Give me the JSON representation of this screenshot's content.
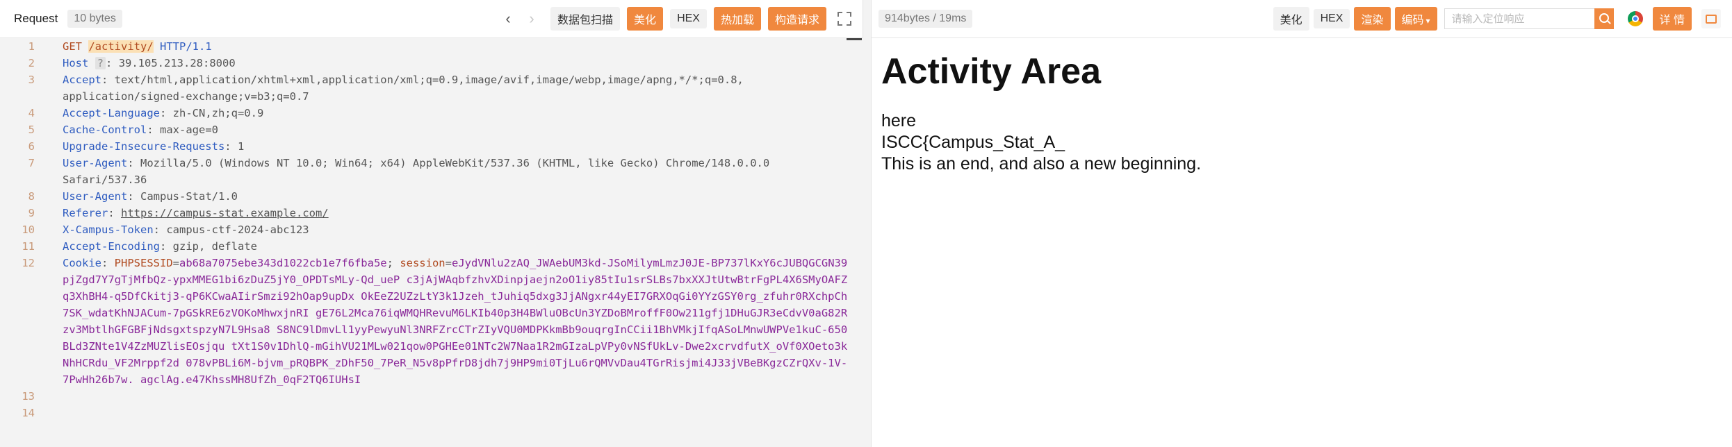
{
  "request": {
    "title": "Request",
    "size": "10 bytes",
    "nav_prev": "‹",
    "nav_next": "›",
    "scan_label": "数据包扫描",
    "beautify_label": "美化",
    "hex_label": "HEX",
    "hotload_label": "热加载",
    "construct_label": "构造请求",
    "hint": "?",
    "lines": {
      "l1": {
        "n": "1",
        "method": "GET",
        "path": "/activity/",
        "proto": "HTTP/1.1"
      },
      "l2": {
        "n": "2",
        "k": "Host",
        "v": "39.105.213.28:8000"
      },
      "l3": {
        "n": "3",
        "k": "Accept",
        "v": "text/html,application/xhtml+xml,application/xml;q=0.9,image/avif,image/webp,image/apng,*/*;q=0.8,",
        "v2": "application/signed-exchange;v=b3;q=0.7"
      },
      "l4": {
        "n": "4",
        "k": "Accept-Language",
        "v": "zh-CN,zh;q=0.9"
      },
      "l5": {
        "n": "5",
        "k": "Cache-Control",
        "v": "max-age=0"
      },
      "l6": {
        "n": "6",
        "k": "Upgrade-Insecure-Requests",
        "v": "1"
      },
      "l7": {
        "n": "7",
        "k": "User-Agent",
        "v": "Mozilla/5.0 (Windows NT 10.0; Win64; x64) AppleWebKit/537.36 (KHTML, like Gecko) Chrome/148.0.0.0",
        "v2": "Safari/537.36"
      },
      "l8": {
        "n": "8",
        "k": "User-Agent",
        "v": "Campus-Stat/1.0"
      },
      "l9": {
        "n": "9",
        "k": "Referer",
        "v": "https://campus-stat.example.com/"
      },
      "l10": {
        "n": "10",
        "k": "X-Campus-Token",
        "v": "campus-ctf-2024-abc123"
      },
      "l11": {
        "n": "11",
        "k": "Accept-Encoding",
        "v": "gzip, deflate"
      },
      "l12": {
        "n": "12",
        "k": "Cookie",
        "c1k": "PHPSESSID",
        "c1v": "ab68a7075ebe343d1022cb1e7f6fba5e",
        "c2k": "session",
        "c2v": "eJydVNlu2zAQ_JWAebUM3kd-JSoMilymLmzJ0JE-BP737lKxY6cJUBQGCGN39pjZgd7Y7gTjMfbQz-ypxMMEG1bi6zDuZ5jY0_OPDTsMLy-Qd_ueP c3jAjWAqbfzhvXDinpjaejn2oO1iy85tIu1srSLBs7bxXXJtUtwBtrFgPL4X6SMyOAFZq3XhBH4-q5DfCkitj3-qP6KCwaAIirSmzi92hOap9upDx OkEeZ2UZzLtY3k1Jzeh_tJuhiq5dxg3JjANgxr44yEI7GRXOqGi0YYzGSY0rg_zfuhr0RXchpCh7SK_wdatKhNJACum-7pGSkRE6zVOKoMhwxjnRI gE76L2Mca76iqWMQHRevuM6LKIb40p3H4BWluOBcUn3YZDoBMroffF0Ow211gfj1DHuGJR3eCdvV0aG82Rzv3MbtlhGFGBFjNdsgxtspzyN7L9Hsa8 S8NC9lDmvLl1yyPewyuNl3NRFZrcCTrZIyVQU0MDPKkmBb9ouqrgInCCii1BhVMkjIfqASoLMnwUWPVe1kuC-650BLd3ZNte1V4ZzMUZlisEOsjqu tXt1S0v1DhlQ-mGihVU21MLw021qow0PGHEe01NTc2W7Naa1R2mGIzaLpVPy0vNSfUkLv-Dwe2xcrvdfutX_oVf0XOeto3kNhHCRdu_VF2Mrppf2d 078vPBLi6M-bjvm_pRQBPK_zDhF50_7PeR_N5v8pPfrD8jdh7j9HP9mi0TjLu6rQMVvDau4TGrRisjmi4J33jVBeBKgzCZrQXv-1V-7PwHh26b7w. agclAg.e47KhssMH8UfZh_0qF2TQ6IUHsI"
      },
      "l13": {
        "n": "13"
      },
      "l14": {
        "n": "14"
      }
    }
  },
  "response": {
    "meta": "914bytes / 19ms",
    "beautify_label": "美化",
    "hex_label": "HEX",
    "render_label": "渲染",
    "encoding_label": "编码",
    "search_placeholder": "请输入定位响应",
    "detail_label": "详 情",
    "heading": "Activity Area",
    "p1": "here",
    "p2": "ISCC{Campus_Stat_A_",
    "p3": "This is an end, and also a new beginning."
  },
  "colors": {
    "accent": "#f0883e",
    "header_key": "#2f5cc0",
    "cookie_value": "#8a2a9a",
    "editor_bg": "#f3f3f3"
  },
  "icons": [
    "chevron-left-icon",
    "chevron-right-icon",
    "expand-icon",
    "search-icon",
    "chrome-icon",
    "message-icon",
    "caret-down-icon"
  ]
}
